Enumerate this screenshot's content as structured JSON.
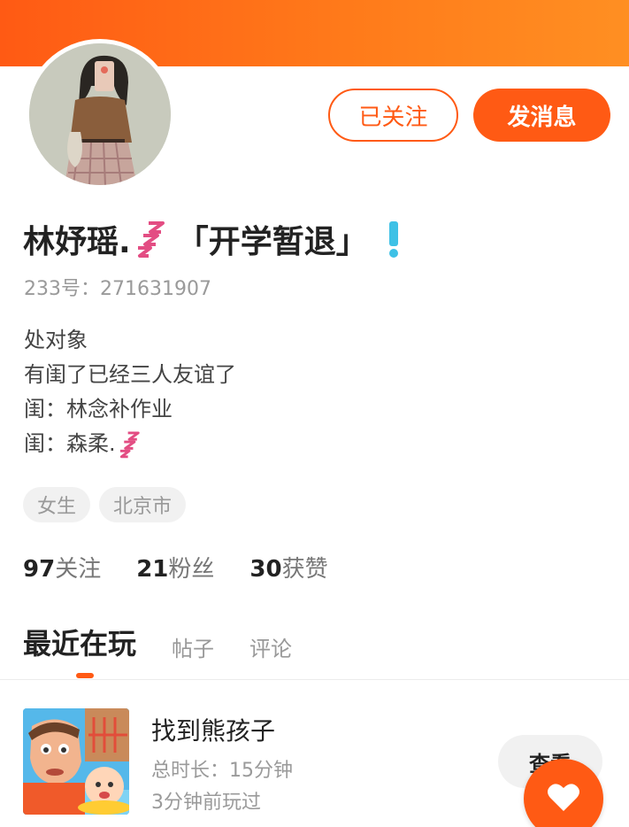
{
  "header": {
    "accent_color": "#ff5a14"
  },
  "profile": {
    "name": "林妤瑶.",
    "name_suffix": "「开学暂退」",
    "name_decoration_icon": "zzz-icon",
    "status_icon": "exclamation-icon",
    "uid": "233号：271631907"
  },
  "actions": {
    "follow_label": "已关注",
    "message_label": "发消息"
  },
  "bio": {
    "lines": [
      "处对象",
      "有闺了已经三人友谊了",
      "闺：林念补作业",
      "闺：森柔."
    ]
  },
  "tags": [
    "女生",
    "北京市"
  ],
  "stats": {
    "following": {
      "value": "97",
      "label": "关注"
    },
    "fans": {
      "value": "21",
      "label": "粉丝"
    },
    "likes": {
      "value": "30",
      "label": "获赞"
    }
  },
  "tabs": [
    "最近在玩",
    "帖子",
    "评论"
  ],
  "active_tab": "最近在玩",
  "recent_game": {
    "title": "找到熊孩子",
    "duration": "总时长：15分钟",
    "last_played": "3分钟前玩过",
    "view_label": "查看"
  },
  "fab": {
    "icon": "heart-icon"
  }
}
